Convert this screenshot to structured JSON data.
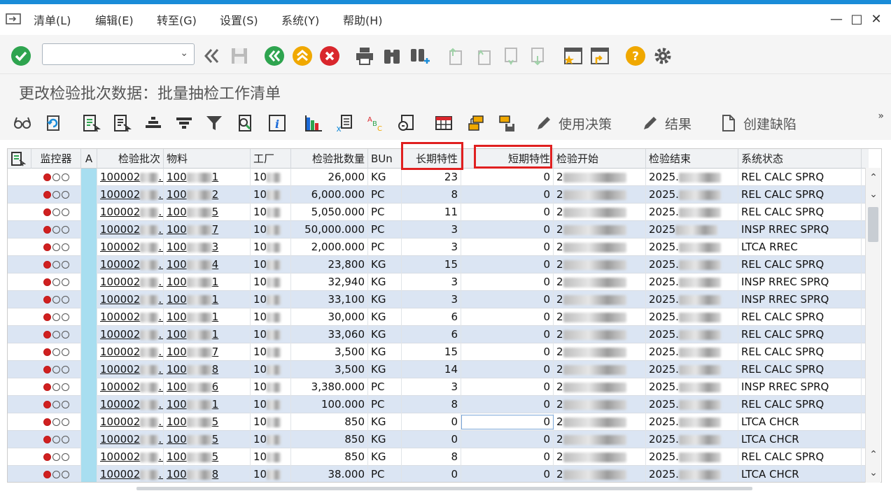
{
  "window": {
    "menus": [
      "清单(L)",
      "编辑(E)",
      "转至(G)",
      "设置(S)",
      "系统(Y)",
      "帮助(H)"
    ],
    "controls": {
      "minimize": "—",
      "maximize": "□",
      "close": "✕"
    }
  },
  "toolbar": {
    "command_field_value": "",
    "icons": [
      "enter-check-icon",
      "back-double-icon",
      "save-icon",
      "back-icon",
      "exit-icon",
      "cancel-icon",
      "print-icon",
      "find-icon",
      "find-next-icon",
      "first-page-icon",
      "prev-page-icon",
      "next-page-icon",
      "last-page-icon",
      "create-session-icon",
      "shortcut-icon",
      "help-icon",
      "settings-icon"
    ]
  },
  "title": "更改检验批次数据：批量抽检工作清单",
  "toolbar2": {
    "icons": [
      "glasses-icon",
      "refresh-icon",
      "detail-icon",
      "select-icon",
      "sort-asc-icon",
      "sort-desc-icon",
      "filter-icon",
      "find-icon",
      "info-icon",
      "chart-icon",
      "excel-icon",
      "abc-icon",
      "print-preview-icon",
      "layout-icon",
      "choose-layout-icon",
      "save-layout-icon"
    ],
    "usage_decision": "使用决策",
    "results": "结果",
    "create_defect": "创建缺陷",
    "more": "»"
  },
  "grid": {
    "headers": {
      "monitor": "监控器",
      "a": "A",
      "lot": "检验批次",
      "material": "物料",
      "plant": "工厂",
      "qty": "检验批数量",
      "bun": "BUn",
      "long_char": "长期特性",
      "short_char": "短期特性",
      "start": "检验开始",
      "end": "检验结束",
      "status": "系统状态"
    },
    "rows": [
      {
        "lot": "100002",
        "lot_tail": "…",
        "mat": "100",
        "mat_tail": "1",
        "plant": "10",
        "qty": "26,000",
        "bun": "KG",
        "long": "23",
        "short": "0",
        "start": "2",
        "end": "2025.",
        "status": "REL  CALC SPRQ"
      },
      {
        "lot": "100002",
        "lot_tail": "…",
        "mat": "100",
        "mat_tail": "2",
        "plant": "10",
        "qty": "6,000.000",
        "bun": "PC",
        "long": "8",
        "short": "0",
        "start": "2",
        "end": "2025.",
        "status": "REL  CALC SPRQ"
      },
      {
        "lot": "100002",
        "lot_tail": "…",
        "mat": "100",
        "mat_tail": "5",
        "plant": "10",
        "qty": "5,050.000",
        "bun": "PC",
        "long": "11",
        "short": "0",
        "start": "2",
        "end": "2025.",
        "status": "REL  CALC SPRQ"
      },
      {
        "lot": "100002",
        "lot_tail": "…",
        "mat": "100",
        "mat_tail": "7",
        "plant": "10",
        "qty": "50,000.000",
        "bun": "PC",
        "long": "3",
        "short": "0",
        "start": "2",
        "end": "2025",
        "status": "INSP RREC SPRQ"
      },
      {
        "lot": "100002",
        "lot_tail": "…",
        "mat": "100",
        "mat_tail": "3",
        "plant": "10",
        "qty": "2,000.000",
        "bun": "PC",
        "long": "3",
        "short": "0",
        "start": "2",
        "end": "2025.",
        "status": "LTCA RREC"
      },
      {
        "lot": "100002",
        "lot_tail": "…",
        "mat": "100",
        "mat_tail": "4",
        "plant": "10",
        "qty": "23,800",
        "bun": "KG",
        "long": "15",
        "short": "0",
        "start": "2",
        "end": "2025.",
        "status": "REL  CALC SPRQ"
      },
      {
        "lot": "100002",
        "lot_tail": "…",
        "mat": "100",
        "mat_tail": "1",
        "plant": "10",
        "qty": "32,940",
        "bun": "KG",
        "long": "3",
        "short": "0",
        "start": "2",
        "end": "2025.",
        "status": "INSP RREC SPRQ"
      },
      {
        "lot": "100002",
        "lot_tail": "…",
        "mat": "100",
        "mat_tail": "1",
        "plant": "10",
        "qty": "33,100",
        "bun": "KG",
        "long": "3",
        "short": "0",
        "start": "2",
        "end": "2025.",
        "status": "INSP RREC SPRQ"
      },
      {
        "lot": "100002",
        "lot_tail": "…",
        "mat": "100",
        "mat_tail": "1",
        "plant": "10",
        "qty": "30,000",
        "bun": "KG",
        "long": "6",
        "short": "0",
        "start": "2",
        "end": "2025.",
        "status": "REL  CALC SPRQ"
      },
      {
        "lot": "100002",
        "lot_tail": "…",
        "mat": "100",
        "mat_tail": "1",
        "plant": "10",
        "qty": "33,060",
        "bun": "KG",
        "long": "6",
        "short": "0",
        "start": "2",
        "end": "2025.",
        "status": "REL  CALC SPRQ"
      },
      {
        "lot": "100002",
        "lot_tail": "…",
        "mat": "100",
        "mat_tail": "7",
        "plant": "10",
        "qty": "3,500",
        "bun": "KG",
        "long": "15",
        "short": "0",
        "start": "2",
        "end": "2025.",
        "status": "REL  CALC SPRQ"
      },
      {
        "lot": "100002",
        "lot_tail": "…",
        "mat": "100",
        "mat_tail": "8",
        "plant": "10",
        "qty": "3,500",
        "bun": "KG",
        "long": "14",
        "short": "0",
        "start": "2",
        "end": "2025.",
        "status": "REL  CALC SPRQ"
      },
      {
        "lot": "100002",
        "lot_tail": "…",
        "mat": "100",
        "mat_tail": "6",
        "plant": "10",
        "qty": "3,380.000",
        "bun": "PC",
        "long": "3",
        "short": "0",
        "start": "2",
        "end": "2025.",
        "status": "INSP RREC SPRQ"
      },
      {
        "lot": "100002",
        "lot_tail": "…",
        "mat": "100",
        "mat_tail": "1",
        "plant": "10",
        "qty": "100.000",
        "bun": "PC",
        "long": "8",
        "short": "0",
        "start": "2",
        "end": "2025.",
        "status": "REL  CALC SPRQ"
      },
      {
        "lot": "100002",
        "lot_tail": "…",
        "mat": "100",
        "mat_tail": "5",
        "plant": "10",
        "qty": "850",
        "bun": "KG",
        "long": "0",
        "short": "0",
        "start": "2",
        "end": "2025.",
        "status": "LTCA CHCR"
      },
      {
        "lot": "100002",
        "lot_tail": "…",
        "mat": "100",
        "mat_tail": "5",
        "plant": "10",
        "qty": "850",
        "bun": "KG",
        "long": "0",
        "short": "0",
        "start": "2",
        "end": "2025.",
        "status": "LTCA CHCR"
      },
      {
        "lot": "100002",
        "lot_tail": "…",
        "mat": "100",
        "mat_tail": "5",
        "plant": "10",
        "qty": "850",
        "bun": "KG",
        "long": "8",
        "short": "0",
        "start": "2",
        "end": "2025.",
        "status": "REL  CALC SPRQ"
      },
      {
        "lot": "100002",
        "lot_tail": "…",
        "mat": "100",
        "mat_tail": "8",
        "plant": "10",
        "qty": "38.000",
        "bun": "PC",
        "long": "0",
        "short": "0",
        "start": "2",
        "end": "2025.",
        "status": "LTCA CHCR"
      }
    ]
  },
  "colors": {
    "accent_line": "#1a8cd8",
    "row_alt": "#dbe5f3",
    "a_column": "#a8def0",
    "highlight_box": "#e02020",
    "traffic_red": "#d02020"
  }
}
